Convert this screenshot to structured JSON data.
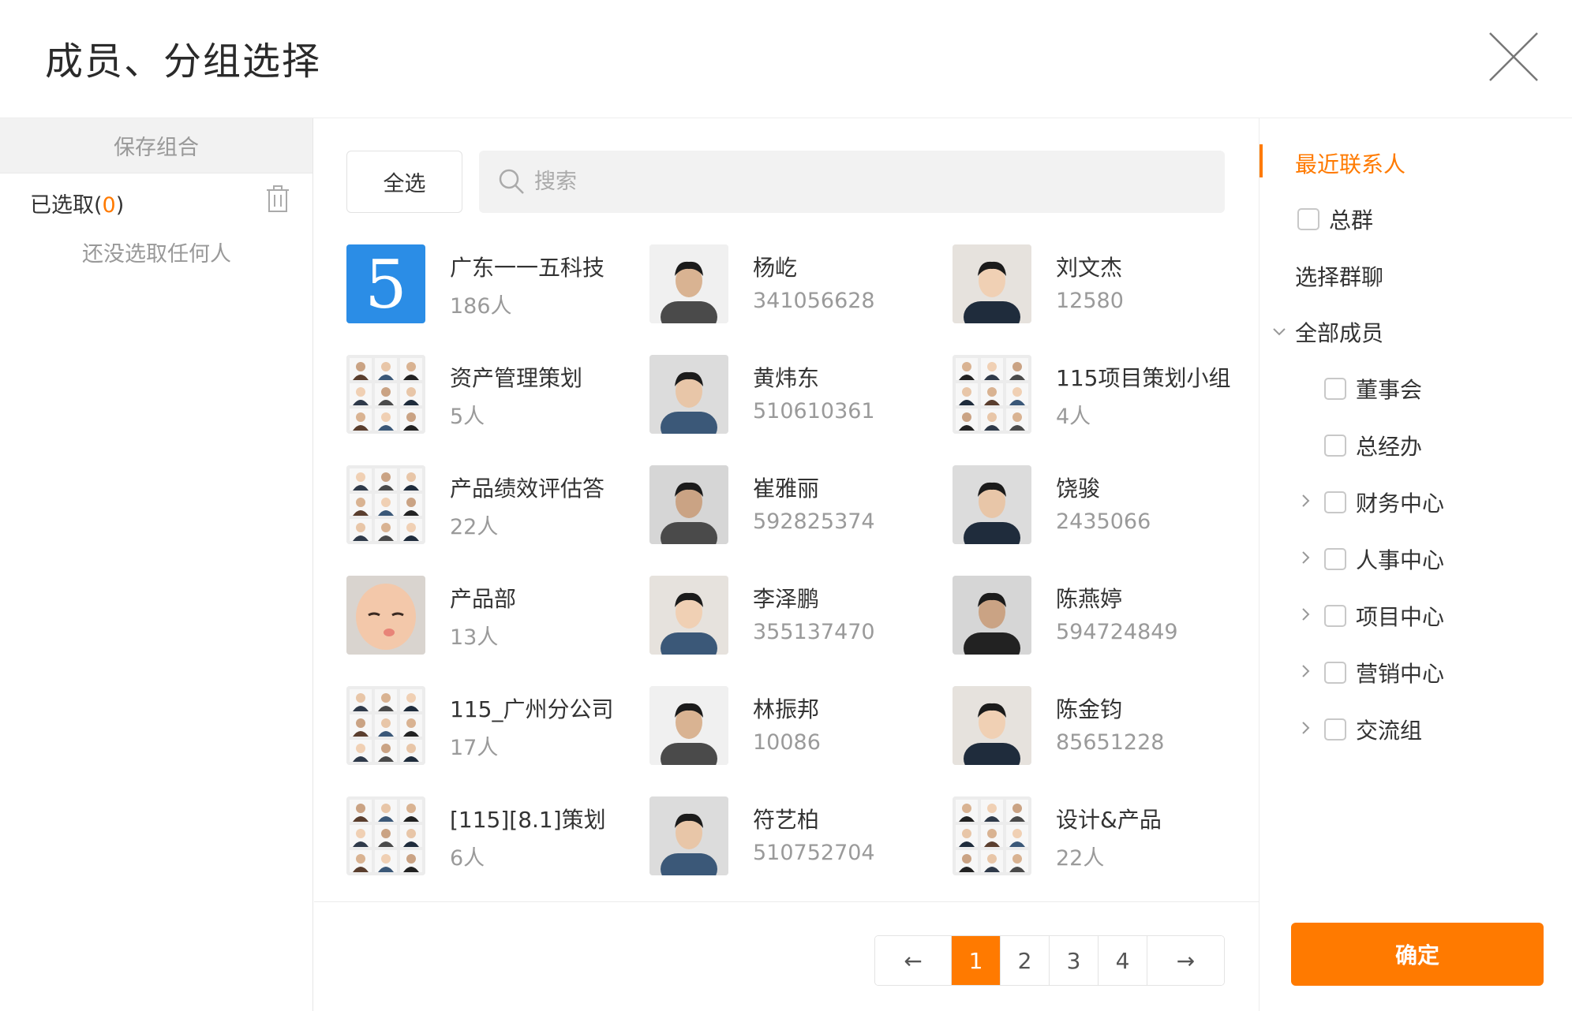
{
  "dialog": {
    "title": "成员、分组选择"
  },
  "left": {
    "save_combo": "保存组合",
    "selected_prefix": "已选取(",
    "selected_count": "0",
    "selected_suffix": ")",
    "empty_hint": "还没选取任何人"
  },
  "toolbar": {
    "select_all": "全选",
    "search_placeholder": "搜索"
  },
  "items": [
    {
      "name": "广东一一五科技",
      "sub": "186人",
      "avatar": "logo-5"
    },
    {
      "name": "杨屹",
      "sub": "341056628",
      "avatar": "person"
    },
    {
      "name": "刘文杰",
      "sub": "12580",
      "avatar": "person"
    },
    {
      "name": "资产管理策划",
      "sub": "5人",
      "avatar": "group-grid"
    },
    {
      "name": "黄炜东",
      "sub": "510610361",
      "avatar": "person"
    },
    {
      "name": "115项目策划小组",
      "sub": "4人",
      "avatar": "group-grid"
    },
    {
      "name": "产品绩效评估答",
      "sub": "22人",
      "avatar": "group-grid"
    },
    {
      "name": "崔雅丽",
      "sub": "592825374",
      "avatar": "person"
    },
    {
      "name": "饶骏",
      "sub": "2435066",
      "avatar": "person"
    },
    {
      "name": "产品部",
      "sub": "13人",
      "avatar": "cartoon-face"
    },
    {
      "name": "李泽鹏",
      "sub": "355137470",
      "avatar": "person"
    },
    {
      "name": "陈燕婷",
      "sub": "594724849",
      "avatar": "person"
    },
    {
      "name": "115_广州分公司",
      "sub": "17人",
      "avatar": "group-grid"
    },
    {
      "name": "林振邦",
      "sub": "10086",
      "avatar": "person"
    },
    {
      "name": "陈金钧",
      "sub": "85651228",
      "avatar": "person"
    },
    {
      "name": "[115][8.1]策划",
      "sub": "6人",
      "avatar": "group-grid"
    },
    {
      "name": "符艺柏",
      "sub": "510752704",
      "avatar": "person"
    },
    {
      "name": "设计&产品",
      "sub": "22人",
      "avatar": "group-grid"
    }
  ],
  "pagination": {
    "prev": "←",
    "next": "→",
    "pages": [
      "1",
      "2",
      "3",
      "4"
    ],
    "current": "1"
  },
  "tree": {
    "recent": "最近联系人",
    "all_group": "总群",
    "choose_chat": "选择群聊",
    "all_members": "全部成员",
    "departments": [
      "董事会",
      "总经办",
      "财务中心",
      "人事中心",
      "项目中心",
      "营销中心",
      "交流组"
    ]
  },
  "confirm": "确定",
  "colors": {
    "accent": "#ff7a00",
    "logo_blue": "#2b8de6"
  }
}
